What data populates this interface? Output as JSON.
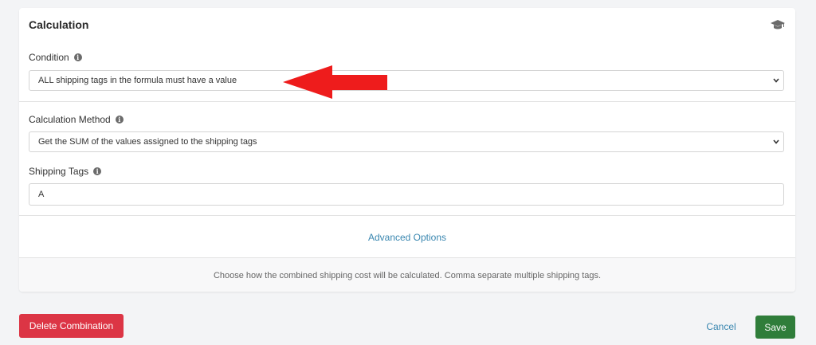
{
  "calculation": {
    "title": "Calculation",
    "condition": {
      "label": "Condition",
      "value": "ALL shipping tags in the formula must have a value"
    },
    "method": {
      "label": "Calculation Method",
      "value": "Get the SUM of the values assigned to the shipping tags"
    },
    "tags": {
      "label": "Shipping Tags",
      "value": "A"
    },
    "advanced_label": "Advanced Options",
    "help_text": "Choose how the combined shipping cost will be calculated. Comma separate multiple shipping tags."
  },
  "actions": {
    "delete_label": "Delete Combination",
    "cancel_label": "Cancel",
    "save_label": "Save"
  },
  "colors": {
    "delete": "#dc3545",
    "save": "#2f7d3a",
    "link": "#3a87b0",
    "annotation_arrow": "#ee1c1c"
  },
  "icons": {
    "header": "graduation-cap-icon",
    "info": "info-icon",
    "select": "chevron-down-icon"
  }
}
